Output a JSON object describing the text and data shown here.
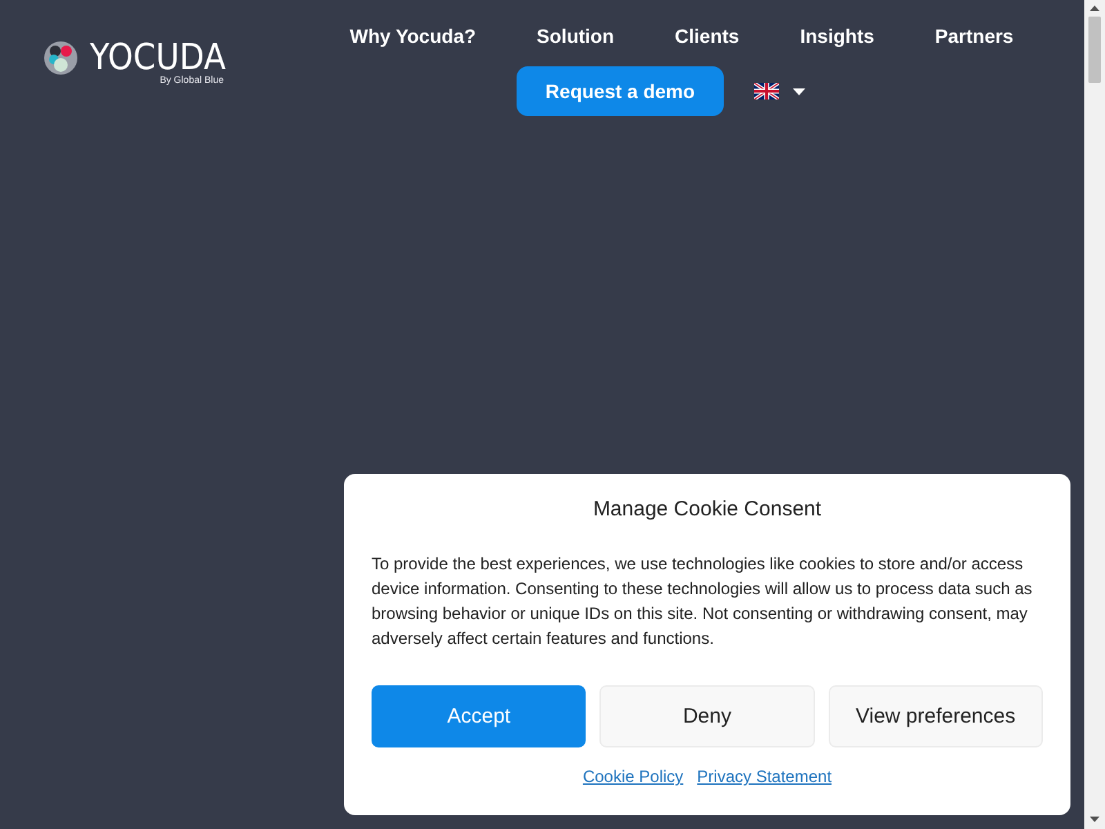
{
  "logo": {
    "name": "YOCUDA",
    "tagline": "By Global Blue"
  },
  "nav": {
    "items": [
      "Why Yocuda?",
      "Solution",
      "Clients",
      "Insights",
      "Partners"
    ],
    "cta": "Request a demo"
  },
  "cookie_dialog": {
    "title": "Manage Cookie Consent",
    "body": "To provide the best experiences, we use technologies like cookies to store and/or access device information. Consenting to these technologies will allow us to process data such as browsing behavior or unique IDs on this site. Not consenting or withdrawing consent, may adversely affect certain features and functions.",
    "buttons": [
      {
        "label": "Accept",
        "kind": "primary"
      },
      {
        "label": "Deny",
        "kind": "secondary"
      },
      {
        "label": "View preferences",
        "kind": "secondary"
      }
    ],
    "links": [
      "Cookie Policy",
      "Privacy Statement"
    ]
  }
}
